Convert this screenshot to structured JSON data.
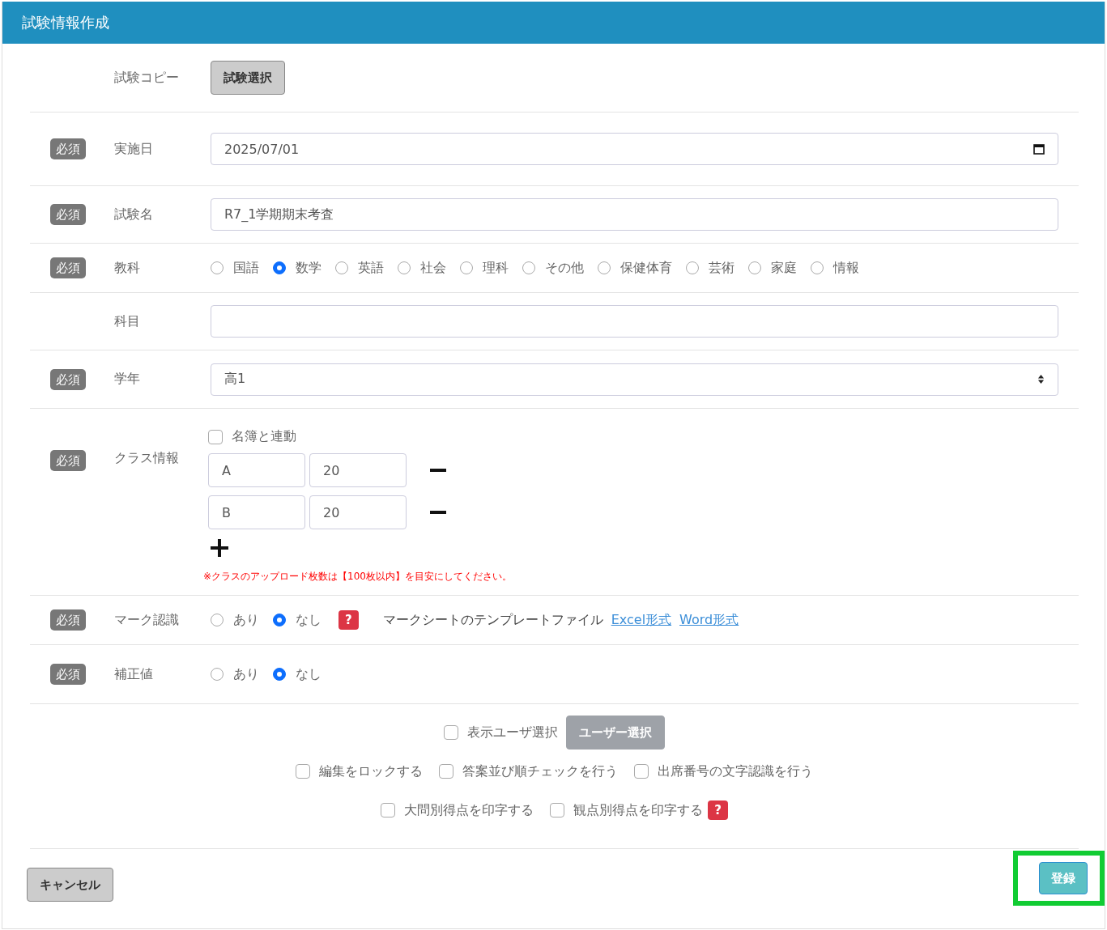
{
  "header": {
    "title": "試験情報作成"
  },
  "rows": [
    {
      "kind": "button",
      "label": "試験コピー",
      "button": "試験選択"
    },
    {
      "kind": "date",
      "badge": "必須",
      "label": "実施日",
      "value": "2025/07/01"
    },
    {
      "kind": "text",
      "badge": "必須",
      "label": "試験名",
      "value": "R7_1学期期末考査"
    },
    {
      "kind": "radio",
      "badge": "必須",
      "label": "教科",
      "options": [
        {
          "label": "国語",
          "selected": false
        },
        {
          "label": "数学",
          "selected": true
        },
        {
          "label": "英語",
          "selected": false
        },
        {
          "label": "社会",
          "selected": false
        },
        {
          "label": "理科",
          "selected": false
        },
        {
          "label": "その他",
          "selected": false
        },
        {
          "label": "保健体育",
          "selected": false
        },
        {
          "label": "芸術",
          "selected": false
        },
        {
          "label": "家庭",
          "selected": false
        },
        {
          "label": "情報",
          "selected": false
        }
      ]
    },
    {
      "kind": "text",
      "label": "科目"
    },
    {
      "kind": "select",
      "badge": "必須",
      "label": "学年",
      "value": "高1"
    },
    {
      "kind": "classes",
      "badge": "必須",
      "label": "クラス情報",
      "checkbox": {
        "label": "名簿と連動",
        "checked": false
      },
      "classes": [
        {
          "name": "A",
          "count": "20"
        },
        {
          "name": "B",
          "count": "20"
        }
      ],
      "note": "※クラスのアップロード枚数は【100枚以内】を目安にしてください。"
    },
    {
      "kind": "radio",
      "badge": "必須",
      "label": "マーク認識",
      "options": [
        {
          "label": "あり",
          "selected": false
        },
        {
          "label": "なし",
          "selected": true
        }
      ],
      "help": "?",
      "template": {
        "label": "マークシートのテンプレートファイル",
        "links": [
          "Excel形式",
          "Word形式"
        ]
      }
    },
    {
      "kind": "radio",
      "badge": "必須",
      "label": "補正値",
      "options": [
        {
          "label": "あり",
          "selected": false
        },
        {
          "label": "なし",
          "selected": true
        }
      ]
    }
  ],
  "options": {
    "user_select": {
      "label": "表示ユーザ選択",
      "checked": false,
      "button": "ユーザー選択",
      "disabled": true
    },
    "lines": [
      [
        {
          "label": "編集をロックする",
          "checked": false
        },
        {
          "label": "答案並び順チェックを行う",
          "checked": false
        },
        {
          "label": "出席番号の文字認識を行う",
          "checked": false
        }
      ],
      [
        {
          "label": "大問別得点を印字する",
          "checked": false
        },
        {
          "label": "観点別得点を印字する",
          "checked": false,
          "help": "?"
        }
      ]
    ]
  },
  "footer": {
    "cancel": "キャンセル",
    "submit": "登録",
    "submit_highlighted": true
  }
}
